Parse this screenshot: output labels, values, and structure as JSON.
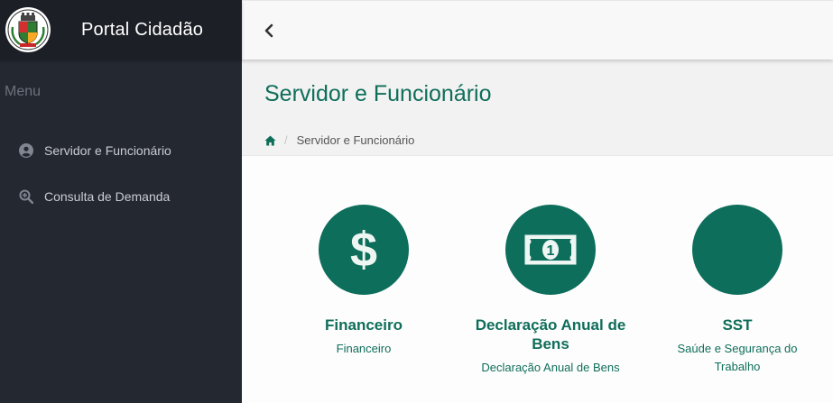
{
  "app": {
    "title": "Portal Cidadão"
  },
  "sidebar": {
    "menu_label": "Menu",
    "items": [
      {
        "label": "Servidor e Funcionário",
        "icon": "user-circle-icon"
      },
      {
        "label": "Consulta de Demanda",
        "icon": "search-plus-icon"
      }
    ]
  },
  "topbar": {
    "collapse_icon": "chevron-left-icon"
  },
  "page": {
    "title": "Servidor e Funcionário",
    "breadcrumb": {
      "home_icon": "home-icon",
      "separator": "/",
      "current": "Servidor e Funcionário"
    }
  },
  "cards": [
    {
      "title": "Financeiro",
      "description": "Financeiro",
      "icon": "dollar-icon"
    },
    {
      "title": "Declaração Anual de Bens",
      "description": "Declaração Anual de Bens",
      "icon": "money-bill-icon"
    },
    {
      "title": "SST",
      "description": "Saúde e Segurança do Trabalho",
      "icon": ""
    }
  ],
  "colors": {
    "sidebar_bg": "#242831",
    "accent": "#0d6e5b",
    "page_header_bg": "#f2f2f2"
  }
}
